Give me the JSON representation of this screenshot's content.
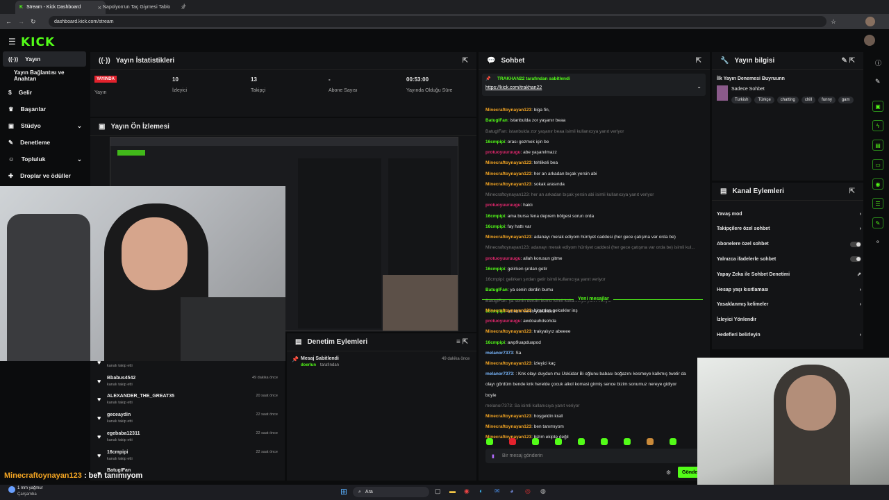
{
  "browser": {
    "tabs": [
      {
        "label": "Stream - Kick Dashboard"
      },
      {
        "label": "Napolyon'un Taç Giymesi Tablo"
      }
    ],
    "url": "dashboard.kick.com/stream"
  },
  "logo": "KICK",
  "sidebar": {
    "items": [
      {
        "label": "Yayın"
      },
      {
        "label": "Yayın Bağlantısı ve Anahtarı"
      },
      {
        "label": "Gelir"
      },
      {
        "label": "Başarılar"
      },
      {
        "label": "Stüdyo"
      },
      {
        "label": "Denetleme"
      },
      {
        "label": "Topluluk"
      },
      {
        "label": "Droplar ve ödüller"
      }
    ]
  },
  "stats": {
    "title": "Yayın İstatistikleri",
    "live_badge": "YAYINDA",
    "items": [
      {
        "value": "",
        "label": "Yayın"
      },
      {
        "value": "10",
        "label": "İzleyici"
      },
      {
        "value": "13",
        "label": "Takipçi"
      },
      {
        "value": "-",
        "label": "Abone Sayısı"
      },
      {
        "value": "00:53:00",
        "label": "Yayında Olduğu Süre"
      }
    ]
  },
  "preview": {
    "title": "Yayın Ön İzlemesi"
  },
  "chat": {
    "title": "Sohbet",
    "pinned_by": "TRAKHAN22 tarafından sabitlendi",
    "pinned_link": "https://kick.com/trakhan22",
    "new_messages": "Yeni mesajlar",
    "placeholder": "Bir mesaj gönderin",
    "send": "Gönder",
    "messages": [
      {
        "user": "Minecraftoynayan123",
        "text": ": biga fin,",
        "color": "orange"
      },
      {
        "user": "BatugIFan",
        "text": ": istanbulda zor yaşanır beaa",
        "color": "green"
      },
      {
        "reply": "BatugIFan: istanbulda zor yaşanır beaa isimli kullanıcıya yanıt veriyor"
      },
      {
        "user": "16cmpipi",
        "text": ": orası gezmek için be",
        "color": "green"
      },
      {
        "user": "protuoyuuruugu",
        "text": ": abe yaşanılmazz",
        "color": "pink"
      },
      {
        "user": "Minecraftoynayan123",
        "text": ": tehlikeli bea",
        "color": "orange"
      },
      {
        "user": "Minecraftoynayan123",
        "text": ": her an arkadan bıçak yersin abi",
        "color": "orange"
      },
      {
        "user": "Minecraftoynayan123",
        "text": ": sokak arasında",
        "color": "orange"
      },
      {
        "reply": "Minecraftoynayan123: her an arkadan bıçak yersin abi isimli kullanıcıya yanıt veriyor"
      },
      {
        "user": "protuoyuuruugu",
        "text": ": haklı",
        "color": "pink"
      },
      {
        "user": "16cmpipi",
        "text": ": ama bursa fena deprem bölgesi sorun orda",
        "color": "green"
      },
      {
        "user": "16cmpipi",
        "text": ": fay hattı var",
        "color": "green"
      },
      {
        "user": "Minecraftoynayan123",
        "text": ": adanayı merak ediyom hürriyet caddesi (her gece çatışma var orda be)",
        "color": "orange"
      },
      {
        "reply": "Minecraftoynayan123: adanayı merak ediyom hürriyet caddesi (her gece çatışma var orda be) isimli kul..."
      },
      {
        "user": "protuoyuuruugu",
        "text": ": allah korusun gitme",
        "color": "pink"
      },
      {
        "user": "16cmpipi",
        "text": ": gelirken şırdan getir",
        "color": "green"
      },
      {
        "reply": "16cmpipi: gelirken şırdan getir isimli kullanıcıya yanıt veriyor"
      },
      {
        "user": "BatugIFan",
        "text": ": ya senin derdin bumu",
        "color": "green"
      },
      {
        "reply": "BatugIFan: ya senin derdin bumu isimli kullanıcıya yanıt veriyor"
      },
      {
        "user": "16cmpipi",
        "text": ": acıktım senin yüzünden",
        "color": "green"
      }
    ],
    "messages2": [
      {
        "user": "Minecraftoynayan123",
        "text": ": birazdan gelcekler inş",
        "color": "orange"
      },
      {
        "user": "protuoyuuruugu",
        "text": ": awdoauhdsohda",
        "color": "pink"
      },
      {
        "user": "Minecraftoynayan123",
        "text": ": trakyalıyız abeeee",
        "color": "orange"
      },
      {
        "user": "16cmpipi",
        "text": ": awp9uapduapod",
        "color": "green"
      },
      {
        "user": "melanor7373",
        "text": ": Sa",
        "color": "blue"
      },
      {
        "user": "Minecraftoynayan123",
        "text": ": izleyici kaç",
        "color": "orange"
      },
      {
        "user": "melanor7373",
        "text": ": : Knk olayı duydun mu Üsküdar Bi oğlunu babası boğazını kesmeye kalkmış twetir da",
        "color": "blue"
      },
      {
        "plain": "olayı gördüm bende knk herelde çocuk alkol komasi girmiş sence bizim sonumuz nereye gidiyor"
      },
      {
        "plain": "boyle"
      },
      {
        "reply": "melanor7373: Sa isimli kullanıcıya yanıt veriyor"
      },
      {
        "user": "Minecraftoynayan123",
        "text": ": hoşgeldin krall",
        "color": "orange"
      },
      {
        "user": "Minecraftoynayan123",
        "text": ": ben tanımıyom",
        "color": "orange"
      },
      {
        "user": "Minecraftoynayan123",
        "text": ": bizim ekipte değil",
        "color": "orange"
      }
    ]
  },
  "stream_info": {
    "title": "Yayın bilgisi",
    "stream_title": "İlk Yayın Denemesi Buyruunn",
    "category": "Sadece Sohbet",
    "tags": [
      "Turkish",
      "Türkçe",
      "chatting",
      "chill",
      "funny",
      "gam"
    ]
  },
  "channel_actions": {
    "title": "Kanal Eylemleri",
    "items": [
      {
        "label": "Yavaş mod",
        "ctl": "arrow"
      },
      {
        "label": "Takipçilere özel sohbet",
        "ctl": "arrow"
      },
      {
        "label": "Abonelere özel sohbet",
        "ctl": "toggle"
      },
      {
        "label": "Yalnızca ifadelerle sohbet",
        "ctl": "toggle"
      },
      {
        "label": "Yapay Zeka ile Sohbet Denetimi",
        "ctl": "ext"
      },
      {
        "label": "Hesap yaşı kısıtlaması",
        "ctl": "arrow"
      },
      {
        "label": "Yasaklanmış kelimeler",
        "ctl": "arrow"
      },
      {
        "label": "İzleyici Yönlendir",
        "ctl": "none"
      },
      {
        "label": "Hedefleri belirleyin",
        "ctl": "arrow"
      }
    ]
  },
  "moderation": {
    "title": "Denetim Eylemleri",
    "action": "Mesaj Sabitlendi",
    "actor": "doerlun",
    "actor_suffix": "tarafından",
    "time": "49 dakika önce"
  },
  "followers": [
    {
      "name": "",
      "sub": "kanalı takip etti",
      "time": ""
    },
    {
      "name": "Bbabus4542",
      "sub": "kanalı takip etti",
      "time": "49 dakika önce"
    },
    {
      "name": "ALEXANDER_THE_GREAT35",
      "sub": "kanalı takip etti",
      "time": "20 saat önce"
    },
    {
      "name": "geceaydin",
      "sub": "kanalı takip etti",
      "time": "22 saat önce"
    },
    {
      "name": "egebaba12311",
      "sub": "kanalı takip etti",
      "time": "22 saat önce"
    },
    {
      "name": "16cmpipi",
      "sub": "kanalı takip etti",
      "time": "22 saat önce"
    },
    {
      "name": "BatugIFan",
      "sub": "",
      "time": ""
    }
  ],
  "overlay": {
    "caption_user": "Minecraftoynayan123",
    "caption_text": " : ben tanımıyom"
  },
  "taskbar": {
    "weather": "1 mm yağmur",
    "day": "Çarşamba",
    "search": "Ara"
  },
  "colors": {
    "accent": "#53fc18",
    "live": "#e3222d",
    "panel": "#131416"
  }
}
